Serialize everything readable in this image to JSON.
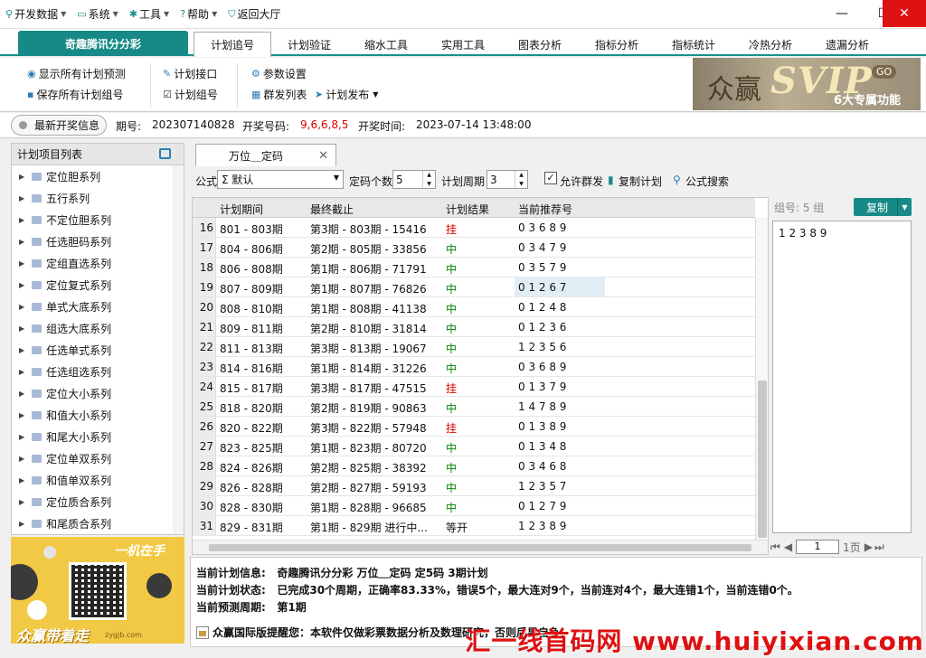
{
  "menu": {
    "items": [
      {
        "label": "开发数据",
        "icon": "pin-icon",
        "caret": true
      },
      {
        "label": "系统",
        "icon": "monitor-icon",
        "caret": true
      },
      {
        "label": "工具",
        "icon": "tools-icon",
        "caret": true
      },
      {
        "label": "帮助",
        "icon": "help-icon",
        "caret": true
      },
      {
        "label": "返回大厅",
        "icon": "shield-icon",
        "caret": false
      }
    ]
  },
  "window": {
    "minimize": "—",
    "maximize": "☐",
    "close": "✕",
    "close_color": "#d11"
  },
  "brand_tab": "奇趣腾讯分分彩",
  "nav_tabs": [
    "计划追号",
    "计划验证",
    "缩水工具",
    "实用工具",
    "图表分析",
    "指标分析",
    "指标统计",
    "冷热分析",
    "遗漏分析"
  ],
  "toolbar": {
    "show_all_predictions": "显示所有计划预测",
    "save_all_groups": "保存所有计划组号",
    "plan_interface": "计划接口",
    "plan_group": "计划组号",
    "param_settings": "参数设置",
    "group_list": "群发列表",
    "plan_publish": "计划发布"
  },
  "svip": {
    "brand": "众赢",
    "main": "SVIP",
    "go": "GO",
    "sub": "6大专属功能"
  },
  "draw_info": {
    "latest_label": "最新开奖信息",
    "period_label": "期号:",
    "period_value": "202307140828",
    "numbers_label": "开奖号码:",
    "numbers_value": "9,6,6,8,5",
    "time_label": "开奖时间:",
    "time_value": "2023-07-14 13:48:00"
  },
  "left_panel": {
    "title": "计划项目列表",
    "items": [
      "定位胆系列",
      "五行系列",
      "不定位胆系列",
      "任选胆码系列",
      "定组直选系列",
      "定位复式系列",
      "单式大底系列",
      "组选大底系列",
      "任选单式系列",
      "任选组选系列",
      "定位大小系列",
      "和值大小系列",
      "和尾大小系列",
      "定位单双系列",
      "和值单双系列",
      "定位质合系列",
      "和尾质合系列"
    ]
  },
  "ad": {
    "title": "一机在手",
    "slogan": "众赢带着走",
    "site": "zygjb.com"
  },
  "doc_tab": {
    "label": "万位＿定码",
    "close": "✕"
  },
  "filters": {
    "formula_label": "公式",
    "formula_value": "Σ 默认",
    "count_label": "定码个数",
    "count_value": "5",
    "cycle_label": "计划周期",
    "cycle_value": "3",
    "allow_group_send": "允许群发",
    "copy_plan": "复制计划",
    "formula_search": "公式搜索"
  },
  "table": {
    "headers": [
      "计划期间",
      "最终截止",
      "计划结果",
      "当前推荐号"
    ],
    "rows": [
      {
        "no": "16",
        "period": "801 - 803期",
        "end": "第3期 - 803期 - 15416",
        "result": "挂",
        "status": "miss",
        "rec": "0 3 6 8 9"
      },
      {
        "no": "17",
        "period": "804 - 806期",
        "end": "第2期 - 805期 - 33856",
        "result": "中",
        "status": "hit",
        "rec": "0 3 4 7 9"
      },
      {
        "no": "18",
        "period": "806 - 808期",
        "end": "第1期 - 806期 - 71791",
        "result": "中",
        "status": "hit",
        "rec": "0 3 5 7 9"
      },
      {
        "no": "19",
        "period": "807 - 809期",
        "end": "第1期 - 807期 - 76826",
        "result": "中",
        "status": "hit",
        "rec": "0 1 2 6 7"
      },
      {
        "no": "20",
        "period": "808 - 810期",
        "end": "第1期 - 808期 - 41138",
        "result": "中",
        "status": "hit",
        "rec": "0 1 2 4 8"
      },
      {
        "no": "21",
        "period": "809 - 811期",
        "end": "第2期 - 810期 - 31814",
        "result": "中",
        "status": "hit",
        "rec": "0 1 2 3 6"
      },
      {
        "no": "22",
        "period": "811 - 813期",
        "end": "第3期 - 813期 - 19067",
        "result": "中",
        "status": "hit",
        "rec": "1 2 3 5 6"
      },
      {
        "no": "23",
        "period": "814 - 816期",
        "end": "第1期 - 814期 - 31226",
        "result": "中",
        "status": "hit",
        "rec": "0 3 6 8 9"
      },
      {
        "no": "24",
        "period": "815 - 817期",
        "end": "第3期 - 817期 - 47515",
        "result": "挂",
        "status": "miss",
        "rec": "0 1 3 7 9"
      },
      {
        "no": "25",
        "period": "818 - 820期",
        "end": "第2期 - 819期 - 90863",
        "result": "中",
        "status": "hit",
        "rec": "1 4 7 8 9"
      },
      {
        "no": "26",
        "period": "820 - 822期",
        "end": "第3期 - 822期 - 57948",
        "result": "挂",
        "status": "miss",
        "rec": "0 1 3 8 9"
      },
      {
        "no": "27",
        "period": "823 - 825期",
        "end": "第1期 - 823期 - 80720",
        "result": "中",
        "status": "hit",
        "rec": "0 1 3 4 8"
      },
      {
        "no": "28",
        "period": "824 - 826期",
        "end": "第2期 - 825期 - 38392",
        "result": "中",
        "status": "hit",
        "rec": "0 3 4 6 8"
      },
      {
        "no": "29",
        "period": "826 - 828期",
        "end": "第2期 - 827期 - 59193",
        "result": "中",
        "status": "hit",
        "rec": "1 2 3 5 7"
      },
      {
        "no": "30",
        "period": "828 - 830期",
        "end": "第1期 - 828期 - 96685",
        "result": "中",
        "status": "hit",
        "rec": "0 1 2 7 9"
      },
      {
        "no": "31",
        "period": "829 - 831期",
        "end": "第1期 - 829期 进行中...",
        "result": "等开",
        "status": "pending",
        "rec": "1 2 3 8 9"
      }
    ]
  },
  "right_panel": {
    "group_label": "组号: 5 组",
    "copy_label": "复制",
    "content": "1 2 3 8 9",
    "page_value": "1",
    "page_total": "1页"
  },
  "bottom": {
    "line1_label": "当前计划信息:",
    "line1_value": "奇趣腾讯分分彩    万位＿定码    定5码    3期计划",
    "line2_label": "当前计划状态:",
    "line2_value": "已完成30个周期，正确率83.33%，错误5个，最大连对9个，当前连对4个，最大连错1个，当前连错0个。",
    "line3_label": "当前预测周期:",
    "line3_value": "第1期",
    "notice": "众赢国际版提醒您：本软件仅做彩票数据分析及数理研究，否则后果自负！"
  },
  "watermark": "汇一线首码网  www.huiyixian.com",
  "colors": {
    "accent": "#178a87",
    "miss": "#d00",
    "hit": "#080"
  }
}
